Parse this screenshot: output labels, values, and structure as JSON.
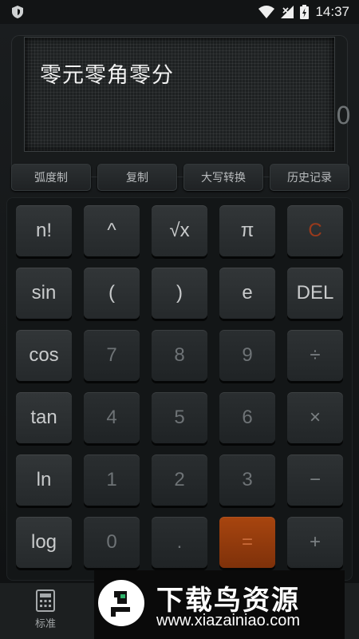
{
  "status_bar": {
    "time": "14:37",
    "icons": [
      "shield-icon",
      "wifi-icon",
      "signal-icon",
      "battery-charging-icon"
    ]
  },
  "display": {
    "text": "零元零角零分",
    "partial_glyph": "0"
  },
  "function_row": [
    {
      "label": "弧度制"
    },
    {
      "label": "复制"
    },
    {
      "label": "大写转换"
    },
    {
      "label": "历史记录"
    }
  ],
  "keypad": {
    "rows": [
      [
        "n!",
        "^",
        "√x",
        "π",
        "C"
      ],
      [
        "sin",
        "(",
        ")",
        "e",
        "DEL"
      ],
      [
        "cos",
        "7",
        "8",
        "9",
        "÷"
      ],
      [
        "tan",
        "4",
        "5",
        "6",
        "×"
      ],
      [
        "ln",
        "1",
        "2",
        "3",
        "−"
      ],
      [
        "log",
        "0",
        ".",
        "=",
        "+"
      ]
    ]
  },
  "tab_bar": {
    "tabs": [
      {
        "label": "标准",
        "icon": "calculator-icon"
      }
    ]
  },
  "watermark": {
    "title": "下载鸟资源",
    "url": "www.xiazainiao.com"
  },
  "colors": {
    "accent_equals": "#a8450f",
    "clear_key": "#9a3a1c"
  }
}
